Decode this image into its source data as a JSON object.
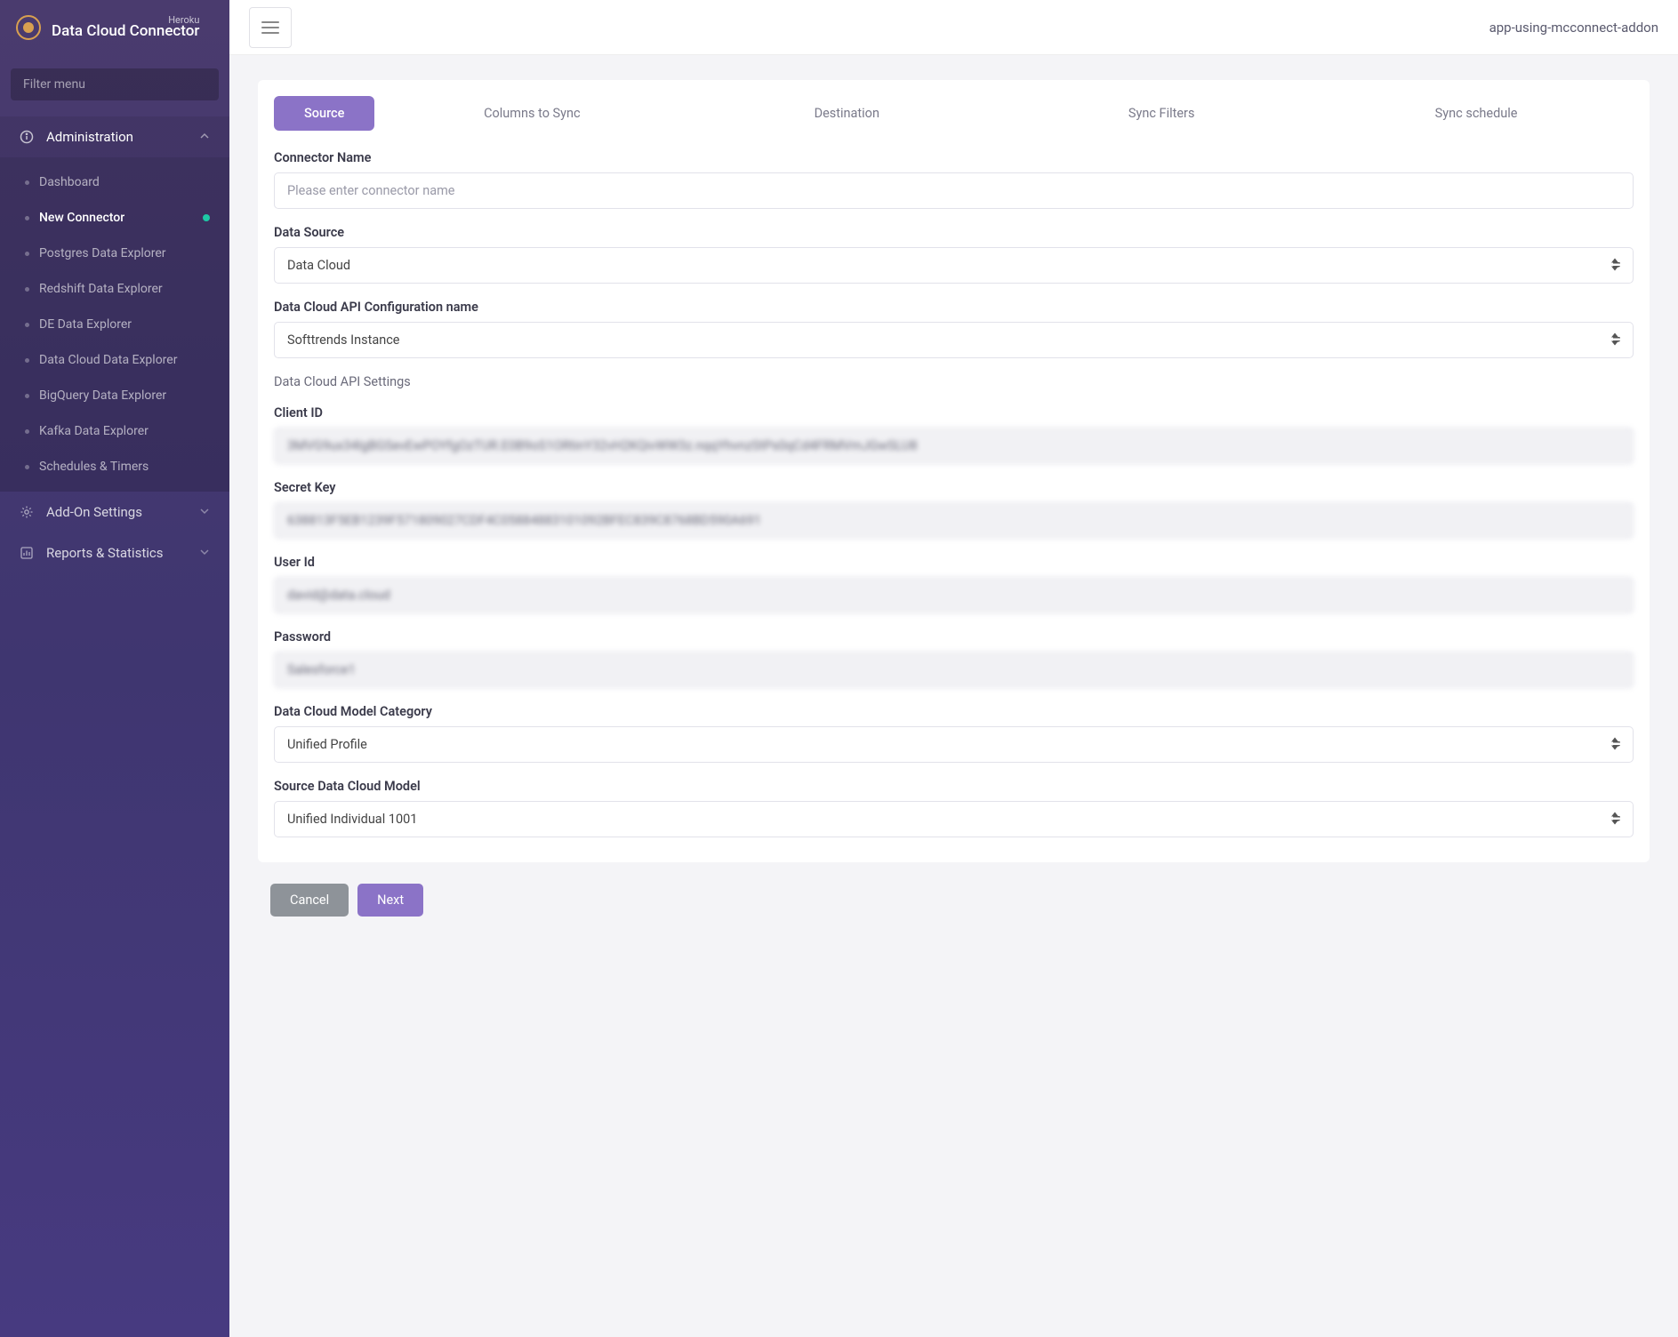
{
  "brand": {
    "small": "Heroku",
    "title": "Data Cloud Connector"
  },
  "filter_placeholder": "Filter menu",
  "nav": {
    "section": "Administration",
    "items": [
      "Dashboard",
      "New Connector",
      "Postgres Data Explorer",
      "Redshift Data Explorer",
      "DE Data Explorer",
      "Data Cloud Data Explorer",
      "BigQuery Data Explorer",
      "Kafka Data Explorer",
      "Schedules & Timers"
    ],
    "addon": "Add-On Settings",
    "reports": "Reports & Statistics"
  },
  "header": {
    "app_name": "app-using-mcconnect-addon"
  },
  "tabs": [
    "Source",
    "Columns to Sync",
    "Destination",
    "Sync Filters",
    "Sync schedule"
  ],
  "form": {
    "connector_name_label": "Connector Name",
    "connector_name_placeholder": "Please enter connector name",
    "data_source_label": "Data Source",
    "data_source_value": "Data Cloud",
    "api_config_label": "Data Cloud API Configuration name",
    "api_config_value": "Softtrends Instance",
    "api_settings_heading": "Data Cloud API Settings",
    "client_id_label": "Client ID",
    "client_id_value": "3MVG9ux34lgBGSevEwPOYfgOzTUR.E0B9oS1ORtinY32vH2KQivWW3z.nqqYhvnzStPs0qCd4FRMVmJGwSLU8",
    "secret_key_label": "Secret Key",
    "secret_key_value": "638813F5EB1239F571809027CDF4C05884883101092BFEC839C8768BD590A691",
    "user_id_label": "User Id",
    "user_id_value": "david@data.cloud",
    "password_label": "Password",
    "password_value": "Salesforce1",
    "category_label": "Data Cloud Model Category",
    "category_value": "Unified Profile",
    "model_label": "Source Data Cloud Model",
    "model_value": "Unified Individual 1001"
  },
  "buttons": {
    "cancel": "Cancel",
    "next": "Next"
  }
}
